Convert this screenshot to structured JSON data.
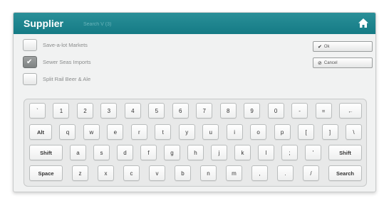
{
  "header": {
    "title": "Supplier",
    "search_placeholder": "Search V (3)",
    "home_icon": "home-icon",
    "accent_color": "#1d848e"
  },
  "suppliers": [
    {
      "label": "Save-a-lot Markets",
      "selected": false
    },
    {
      "label": "Sewer Seas Imports",
      "selected": true
    },
    {
      "label": "Split Rail Beer & Ale",
      "selected": false
    }
  ],
  "actions": {
    "ok_label": "Ok",
    "ok_icon": "check-icon",
    "cancel_label": "Cancel",
    "cancel_icon": "cancel-icon"
  },
  "keyboard": {
    "rows": [
      [
        "`",
        "1",
        "2",
        "3",
        "4",
        "5",
        "6",
        "7",
        "8",
        "9",
        "0",
        "-",
        "=",
        "←"
      ],
      [
        "Alt",
        "q",
        "w",
        "e",
        "r",
        "t",
        "y",
        "u",
        "i",
        "o",
        "p",
        "[",
        "]",
        "\\"
      ],
      [
        "Shift",
        "a",
        "s",
        "d",
        "f",
        "g",
        "h",
        "j",
        "k",
        "l",
        ";",
        "'",
        "Shift"
      ],
      [
        "Space",
        "z",
        "x",
        "c",
        "v",
        "b",
        "n",
        "m",
        ",",
        ".",
        "/",
        "Search"
      ]
    ]
  }
}
